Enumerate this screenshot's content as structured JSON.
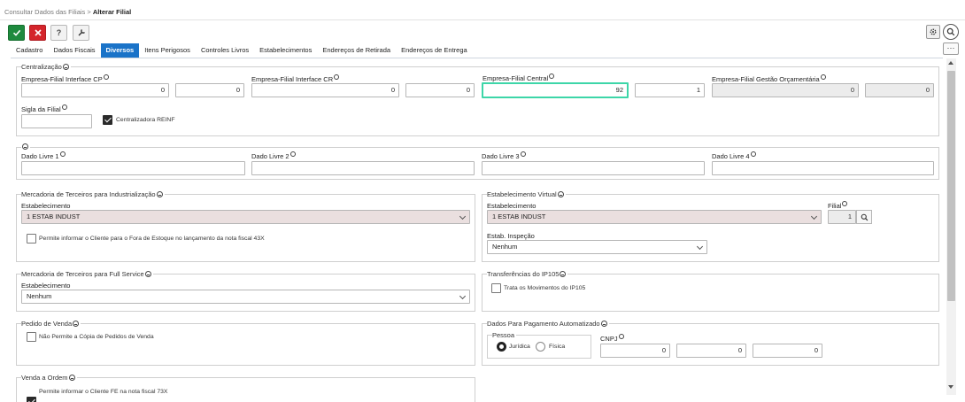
{
  "breadcrumb": {
    "parent": "Consultar Dados das Filiais",
    "separator": ">",
    "current": "Alterar Filial"
  },
  "tabs": [
    "Cadastro",
    "Dados Fiscais",
    "Diversos",
    "Itens Perigosos",
    "Controles Livros",
    "Estabelecimentos",
    "Endereços de Retirada",
    "Endereços de Entrega"
  ],
  "active_tab": "Diversos",
  "more_label": "···",
  "centralizacao": {
    "legend": "Centralização",
    "interface_cp": {
      "label": "Empresa-Filial Interface CP",
      "empresa": "0",
      "filial": "0"
    },
    "interface_cr": {
      "label": "Empresa-Filial Interface CR",
      "empresa": "0",
      "filial": "0"
    },
    "central": {
      "label": "Empresa-Filial Central",
      "empresa": "92",
      "filial": "1"
    },
    "gestao": {
      "label": "Empresa-Filial Gestão Orçamentária",
      "empresa": "0",
      "filial": "0"
    },
    "sigla": {
      "label": "Sigla da Filial",
      "value": ""
    },
    "reinf": {
      "label": "Centralizadora REINF",
      "checked": true
    }
  },
  "dados_livres": {
    "legend": "",
    "fields": [
      {
        "label": "Dado Livre 1",
        "value": ""
      },
      {
        "label": "Dado Livre 2",
        "value": ""
      },
      {
        "label": "Dado Livre 3",
        "value": ""
      },
      {
        "label": "Dado Livre 4",
        "value": ""
      }
    ]
  },
  "mercadoria_industrializacao": {
    "legend": "Mercadoria de Terceiros para Industrialização",
    "estab_label": "Estabelecimento",
    "estab_value": "1 ESTAB INDUST",
    "checkbox_label": "Permite informar o Cliente para o Fora de Estoque no lançamento da nota fiscal 43X"
  },
  "estabelecimento_virtual": {
    "legend": "Estabelecimento Virtual",
    "estab_label": "Estabelecimento",
    "estab_value": "1 ESTAB INDUST",
    "filial_label": "Filial",
    "filial_value": "1",
    "inspecao_label": "Estab. Inspeção",
    "inspecao_value": "Nenhum"
  },
  "full_service": {
    "legend": "Mercadoria de Terceiros para Full Service",
    "estab_label": "Estabelecimento",
    "estab_value": "Nenhum"
  },
  "transferencias": {
    "legend": "Transferências do IP105",
    "checkbox_label": "Trata os Movimentos do IP105"
  },
  "pedido_venda": {
    "legend": "Pedido de Venda",
    "checkbox_label": "Não Permite a Cópia de Pedidos de Venda"
  },
  "pagamento": {
    "legend": "Dados Para Pagamento Automatizado",
    "pessoa_label": "Pessoa",
    "juridica": "Jurídica",
    "fisica": "Física",
    "cnpj_label": "CNPJ",
    "cnpj_values": [
      "0",
      "0",
      "0"
    ]
  },
  "venda_ordem": {
    "legend": "Venda a Ordem",
    "checkbox_label": "Permite informar o Cliente FE na nota fiscal 73X"
  }
}
